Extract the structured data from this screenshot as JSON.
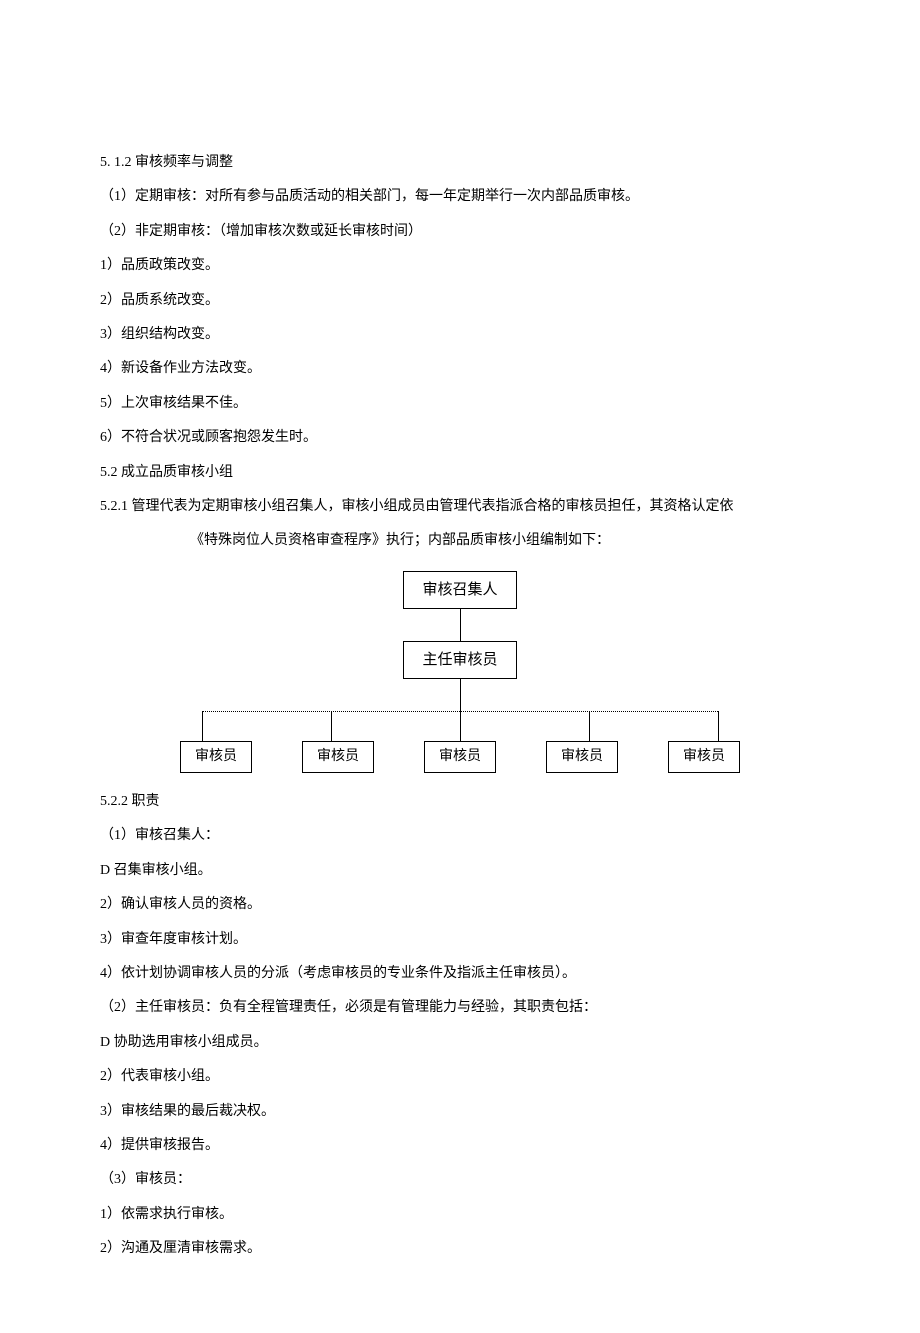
{
  "s512": {
    "num": "5.  1.2",
    "title": "审核频率与调整",
    "item1_num": "（1）",
    "item1_label": "定期审核：",
    "item1_text": "对所有参与品质活动的相关部门，每一年定期举行一次内部品质审核。",
    "item2_num": "（2）",
    "item2_label": "非定期审核：",
    "item2_text": "（增加审核次数或延长审核时间）",
    "sub": [
      "1）品质政策改变。",
      "2）品质系统改变。",
      "3）组织结构改变。",
      "4）新设备作业方法改变。",
      "5）上次审核结果不佳。",
      "6）不符合状况或顾客抱怨发生时。"
    ]
  },
  "s52": {
    "num": "5.2",
    "title": "成立品质审核小组"
  },
  "s521": {
    "num": "5.2.1",
    "text_a": "管理代表为定期审核小组召集人，审核小组成员由管理代表指派合格的审核员担任，其资格认定依",
    "text_b": "《特殊岗位人员资格审查程序》执行；内部品质审核小组编制如下："
  },
  "chart_data": {
    "type": "diagram",
    "root": "审核召集人",
    "mid": "主任审核员",
    "leaves": [
      "审核员",
      "审核员",
      "审核员",
      "审核员",
      "审核员"
    ]
  },
  "s522": {
    "num": "5.2.2",
    "title": "职责",
    "r1_num": "（1）",
    "r1_label": "审核召集人：",
    "r1_items": [
      "D 召集审核小组。",
      "2）确认审核人员的资格。",
      "3）审查年度审核计划。",
      "4）依计划协调审核人员的分派（考虑审核员的专业条件及指派主任审核员）。"
    ],
    "r2_num": "（2）",
    "r2_label": "主任审核员：",
    "r2_text": "负有全程管理责任，必须是有管理能力与经验，其职责包括：",
    "r2_items": [
      "D 协助选用审核小组成员。",
      "2）代表审核小组。",
      "3）审核结果的最后裁决权。",
      "4）提供审核报告。"
    ],
    "r3_num": "（3）",
    "r3_label": "审核员：",
    "r3_items": [
      "1）依需求执行审核。",
      "2）沟通及厘清审核需求。"
    ]
  }
}
